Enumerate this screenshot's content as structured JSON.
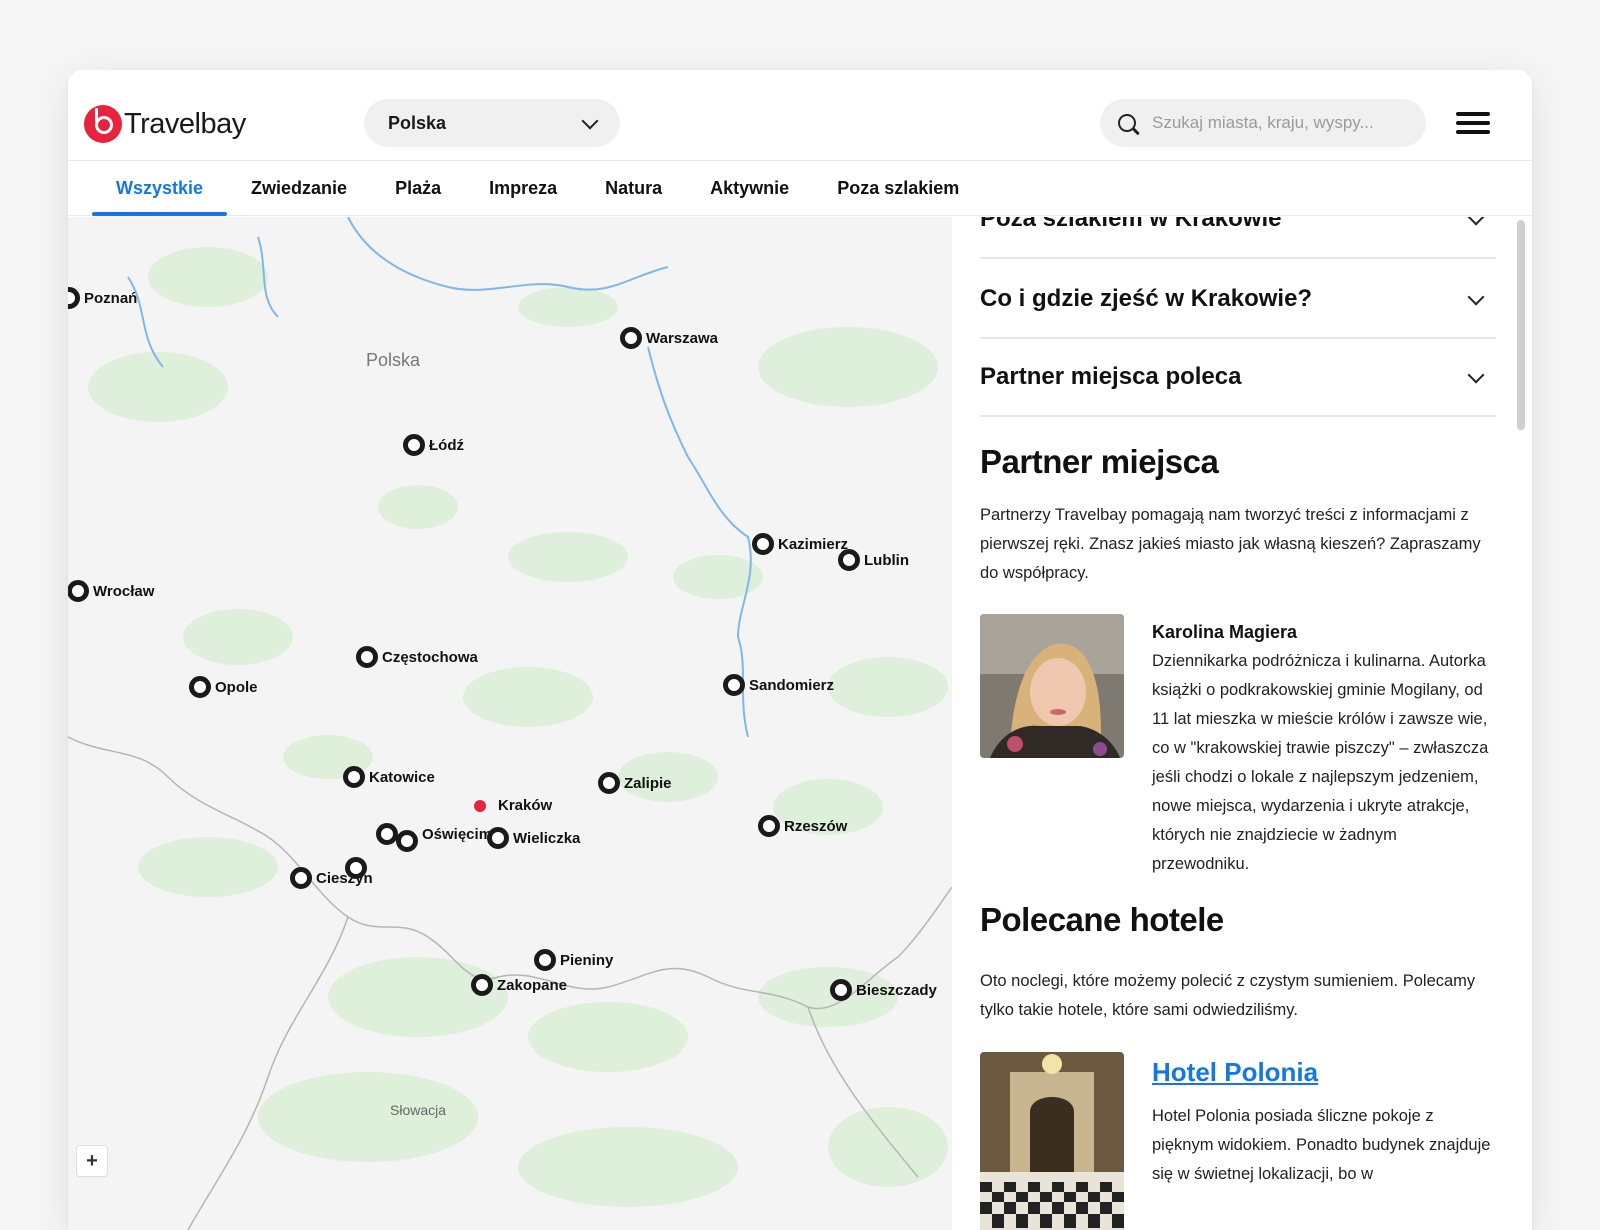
{
  "header": {
    "logo_text": "Travelbay",
    "country_select": "Polska",
    "search_placeholder": "Szukaj miasta, kraju, wyspy..."
  },
  "tabs": [
    {
      "label": "Wszystkie",
      "active": true
    },
    {
      "label": "Zwiedzanie"
    },
    {
      "label": "Plaża"
    },
    {
      "label": "Impreza"
    },
    {
      "label": "Natura"
    },
    {
      "label": "Aktywnie"
    },
    {
      "label": "Poza szlakiem"
    }
  ],
  "map": {
    "region_labels": {
      "country": "Polska",
      "neighbor": "Słowacja"
    },
    "zoom_in": "+",
    "markers": [
      {
        "name": "Poznań"
      },
      {
        "name": "Warszawa"
      },
      {
        "name": "Łódź"
      },
      {
        "name": "Kazimierz"
      },
      {
        "name": "Lublin"
      },
      {
        "name": "Wrocław"
      },
      {
        "name": "Częstochowa"
      },
      {
        "name": "Opole"
      },
      {
        "name": "Sandomierz"
      },
      {
        "name": "Katowice"
      },
      {
        "name": "Zalipie"
      },
      {
        "name": "Kraków",
        "selected": true
      },
      {
        "name": "Oświęcim"
      },
      {
        "name": "Wieliczka"
      },
      {
        "name": "Rzeszów"
      },
      {
        "name": "Cieszyn"
      },
      {
        "name": "Pieniny"
      },
      {
        "name": "Zakopane"
      },
      {
        "name": "Bieszczady"
      }
    ]
  },
  "panel": {
    "accordions": [
      "Poza szlakiem w Krakowie",
      "Co i gdzie zjeść w Krakowie?",
      "Partner miejsca poleca"
    ],
    "partner": {
      "heading": "Partner miejsca",
      "intro": "Partnerzy Travelbay pomagają nam tworzyć treści z informacjami z pierwszej ręki. Znasz jakieś miasto jak własną kieszeń? Zapraszamy do współpracy.",
      "name": "Karolina Magiera",
      "bio": "Dziennikarka podróżnicza i kulinarna. Autorka książki o podkrakowskiej gminie Mogilany, od 11 lat mieszka w mieście królów i zawsze wie, co w \"krakowskiej trawie piszczy\" – zwłaszcza jeśli chodzi o lokale z najlepszym jedzeniem, nowe miejsca, wydarzenia i ukryte atrakcje, których nie znajdziecie w żadnym przewodniku."
    },
    "hotels": {
      "heading": "Polecane hotele",
      "intro": "Oto noclegi, które możemy polecić z czystym sumieniem. Polecamy tylko takie hotele, które sami odwiedziliśmy.",
      "items": [
        {
          "name": "Hotel Polonia",
          "description": "Hotel Polonia posiada śliczne pokoje z pięknym widokiem. Ponadto budynek znajduje się w świetnej lokalizacji, bo w"
        }
      ]
    }
  }
}
